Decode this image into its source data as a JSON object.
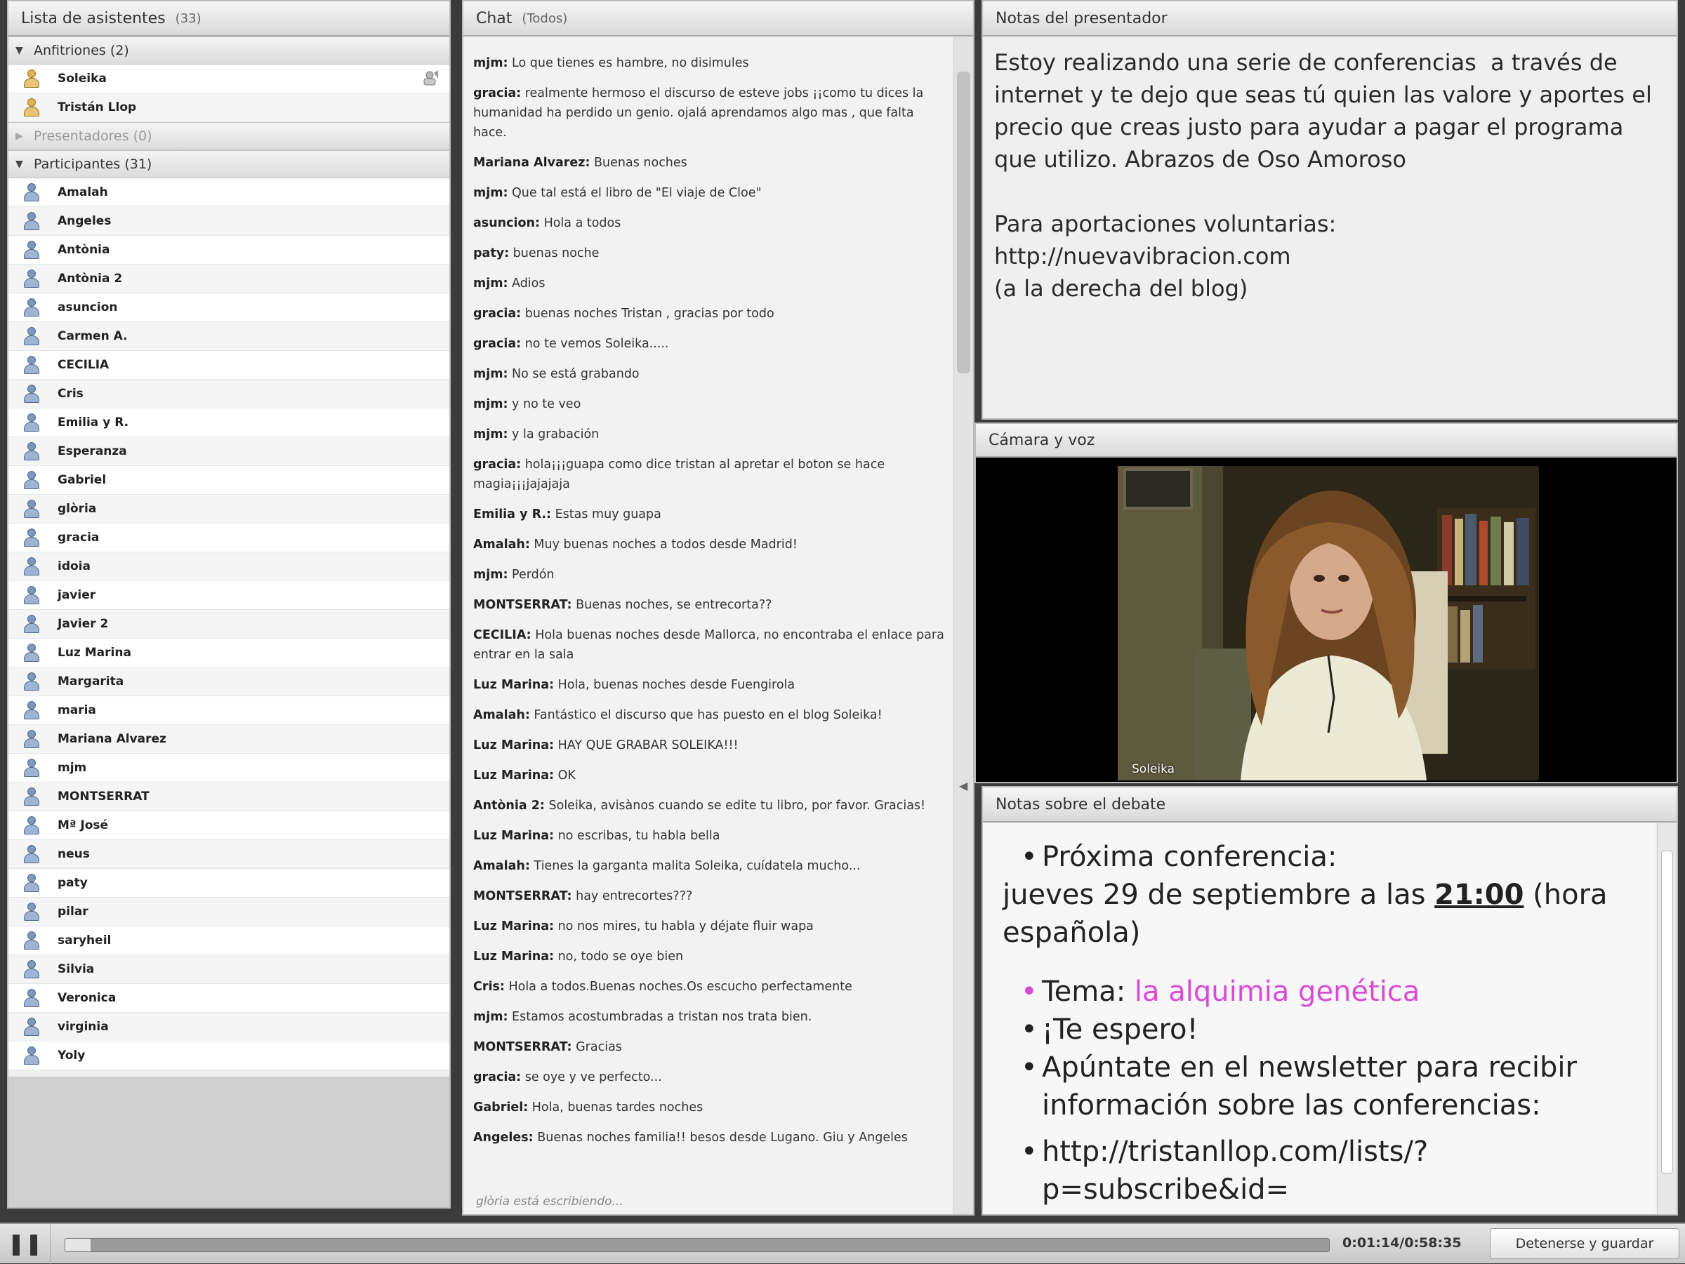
{
  "attendees": {
    "title": "Lista de asistentes",
    "count": "(33)",
    "hosts_group": "Anfitriones (2)",
    "hosts": [
      "Soleika",
      "Tristán Llop"
    ],
    "presenters_group": "Presentadores (0)",
    "participants_group": "Participantes (31)",
    "participants": [
      "Amalah",
      "Angeles",
      "Antònia",
      "Antònia 2",
      "asuncion",
      "Carmen A.",
      "CECILIA",
      "Cris",
      "Emilia y R.",
      "Esperanza",
      "Gabriel",
      "glòria",
      "gracia",
      "idoia",
      "javier",
      "Javier 2",
      "Luz Marina",
      "Margarita",
      "maria",
      "Mariana Alvarez",
      "mjm",
      "MONTSERRAT",
      "Mª José",
      "neus",
      "paty",
      "pilar",
      "saryheil",
      "Silvia",
      "Veronica",
      "virginia",
      "Yoly"
    ]
  },
  "chat": {
    "title": "Chat",
    "scope": "(Todos)",
    "messages": [
      {
        "who": "mjm:",
        "text": " Lo que tienes es hambre, no disimules"
      },
      {
        "who": "gracia:",
        "text": " realmente hermoso el discurso de esteve jobs ¡¡como tu dices la humanidad ha perdido un genio. ojalá aprendamos algo mas , que falta hace."
      },
      {
        "who": "Mariana Alvarez:",
        "text": " Buenas noches"
      },
      {
        "who": "mjm:",
        "text": " Que tal está el libro de \"El viaje de Cloe\""
      },
      {
        "who": "asuncion:",
        "text": " Hola a todos"
      },
      {
        "who": "paty:",
        "text": " buenas noche"
      },
      {
        "who": "mjm:",
        "text": " Adios"
      },
      {
        "who": "gracia:",
        "text": " buenas noches Tristan , gracias por todo"
      },
      {
        "who": "gracia:",
        "text": " no te vemos Soleika....."
      },
      {
        "who": "mjm:",
        "text": " No se está grabando"
      },
      {
        "who": "mjm:",
        "text": " y no te veo"
      },
      {
        "who": "mjm:",
        "text": " y la grabación"
      },
      {
        "who": "gracia:",
        "text": " hola¡¡¡guapa como dice tristan al apretar el boton se hace magia¡¡¡jajajaja"
      },
      {
        "who": "Emilia y R.:",
        "text": " Estas muy guapa"
      },
      {
        "who": "Amalah:",
        "text": " Muy buenas noches a todos desde Madrid!"
      },
      {
        "who": "mjm:",
        "text": " Perdón"
      },
      {
        "who": "MONTSERRAT:",
        "text": " Buenas noches, se entrecorta??"
      },
      {
        "who": "CECILIA:",
        "text": " Hola buenas noches desde Mallorca, no encontraba el enlace para entrar en la sala"
      },
      {
        "who": "Luz Marina:",
        "text": " Hola, buenas noches desde Fuengirola"
      },
      {
        "who": "Amalah:",
        "text": " Fantástico el discurso que has puesto en el blog Soleika!"
      },
      {
        "who": "Luz Marina:",
        "text": " HAY QUE GRABAR SOLEIKA!!!"
      },
      {
        "who": "Luz Marina:",
        "text": " OK"
      },
      {
        "who": "Antònia 2:",
        "text": " Soleika, avisànos cuando se edite tu libro, por favor. Gracias!"
      },
      {
        "who": "Luz Marina:",
        "text": " no escribas, tu habla bella"
      },
      {
        "who": "Amalah:",
        "text": " Tienes la garganta malita Soleika, cuídatela mucho..."
      },
      {
        "who": "MONTSERRAT:",
        "text": " hay entrecortes???"
      },
      {
        "who": "Luz Marina:",
        "text": " no nos mires, tu habla y déjate fluir wapa"
      },
      {
        "who": "Luz Marina:",
        "text": " no, todo se oye bien"
      },
      {
        "who": "Cris:",
        "text": " Hola a todos.Buenas noches.Os escucho perfectamente"
      },
      {
        "who": "mjm:",
        "text": " Estamos acostumbradas a tristan nos trata bien."
      },
      {
        "who": "MONTSERRAT:",
        "text": " Gracias"
      },
      {
        "who": "gracia:",
        "text": " se oye y ve perfecto..."
      },
      {
        "who": "Gabriel:",
        "text": " Hola, buenas tardes noches"
      },
      {
        "who": "Angeles:",
        "text": " Buenas noches familia!! besos desde Lugano. Giu y Angeles"
      }
    ],
    "typing": "glòria está escribiendo..."
  },
  "notes": {
    "title": "Notas del presentador",
    "body": "Estoy realizando una serie de conferencias  a través de internet y te dejo que seas tú quien las valore y aportes el precio que creas justo para ayudar a pagar el programa que utilizo. Abrazos de Oso Amoroso\n\nPara aportaciones voluntarias:\nhttp://nuevavibracion.com\n(a la derecha del blog)"
  },
  "camera": {
    "title": "Cámara y voz",
    "label": "Soleika"
  },
  "debate": {
    "title": "Notas sobre el debate",
    "next_label": "Próxima conferencia:",
    "date_prefix": "jueves 29 de septiembre a las ",
    "time": "21:00",
    "date_suffix": " (hora española)",
    "topic_label": "Tema: ",
    "topic": "la alquimia genética",
    "wait": "¡Te espero!",
    "newsletter": "Apúntate en el newsletter para recibir información sobre las conferencias:",
    "link": "http://tristanllop.com/lists/?p=subscribe&id="
  },
  "playback": {
    "time": "0:01:14/0:58:35",
    "stop_label": "Detenerse y guardar",
    "progress": 0.02
  },
  "colors": {
    "accent_pink": "#d94ad8"
  }
}
